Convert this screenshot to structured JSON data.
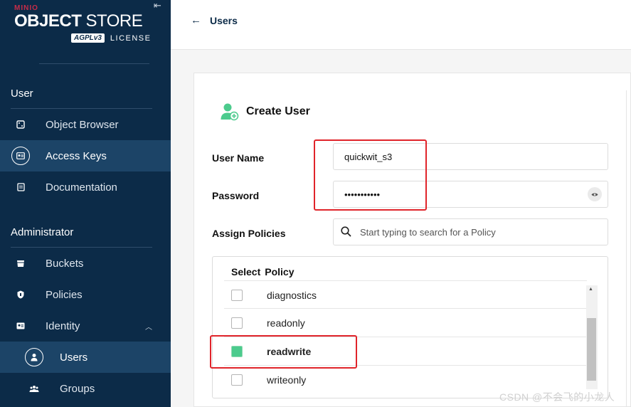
{
  "brand": {
    "vendor": "MINIO",
    "product_bold": "OBJECT",
    "product_thin": "STORE",
    "license_badge": "AGPLv3",
    "license_text": "LICENSE"
  },
  "sidebar": {
    "section_user": "User",
    "user_items": [
      {
        "label": "Object Browser",
        "icon": "object-browser-icon"
      },
      {
        "label": "Access Keys",
        "icon": "access-keys-icon",
        "active": true
      },
      {
        "label": "Documentation",
        "icon": "documentation-icon"
      }
    ],
    "section_admin": "Administrator",
    "admin_items": [
      {
        "label": "Buckets",
        "icon": "buckets-icon"
      },
      {
        "label": "Policies",
        "icon": "policies-icon"
      },
      {
        "label": "Identity",
        "icon": "identity-icon",
        "expanded": true
      },
      {
        "label": "Users",
        "icon": "user-icon",
        "active": true
      },
      {
        "label": "Groups",
        "icon": "groups-icon"
      }
    ]
  },
  "header": {
    "back_label": "Users"
  },
  "form": {
    "title": "Create User",
    "username_label": "User Name",
    "username_value": "quickwit_s3",
    "password_label": "Password",
    "password_value": "•••••••••••",
    "policies_label": "Assign Policies",
    "search_placeholder": "Start typing to search for a Policy"
  },
  "policy_table": {
    "col_select": "Select",
    "col_policy": "Policy",
    "rows": [
      {
        "name": "diagnostics",
        "checked": false
      },
      {
        "name": "readonly",
        "checked": false
      },
      {
        "name": "readwrite",
        "checked": true
      },
      {
        "name": "writeonly",
        "checked": false
      }
    ]
  },
  "colors": {
    "sidebar_bg": "#0c2b48",
    "brand_red": "#c72c48",
    "check_green": "#4ccb8d",
    "highlight_red": "#e0242a"
  },
  "watermark": "CSDN @不会飞的小龙人"
}
